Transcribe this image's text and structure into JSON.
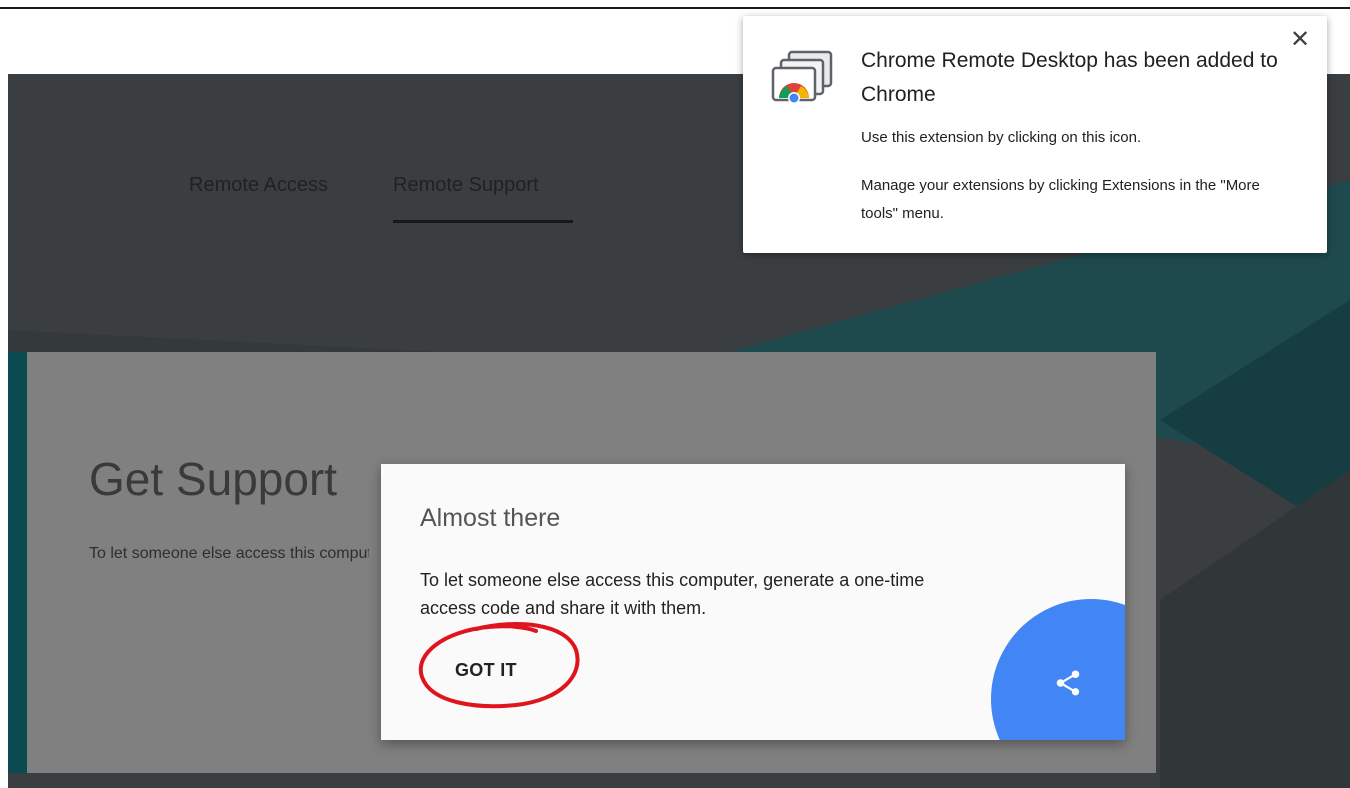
{
  "nav": {
    "tabs": [
      {
        "label": "Remote Access"
      },
      {
        "label": "Remote Support"
      }
    ],
    "active_tab": "Remote Support"
  },
  "card": {
    "title": "Get Support",
    "description": "To let someone else access this computer, generate a one-time access code and share it with them."
  },
  "dialog": {
    "title": "Almost there",
    "body": "To let someone else access this computer, generate a one-time access code and share it with them.",
    "got_it_label": "GOT IT",
    "fab_icon": "share-icon"
  },
  "toast": {
    "icon": "chrome-remote-desktop-icon",
    "title": "Chrome Remote Desktop has been added to Chrome",
    "line1": "Use this extension by clicking on this icon.",
    "line2": "Manage your extensions by clicking Extensions in the \"More tools\" menu.",
    "close_icon": "close-icon",
    "close_glyph": "✕"
  },
  "colors": {
    "header_bg": "#3a3e41",
    "teal_accent": "#0b4a51",
    "card_bg": "#808080",
    "fab_blue": "#4285f4",
    "annotation_red": "#e0141e"
  }
}
